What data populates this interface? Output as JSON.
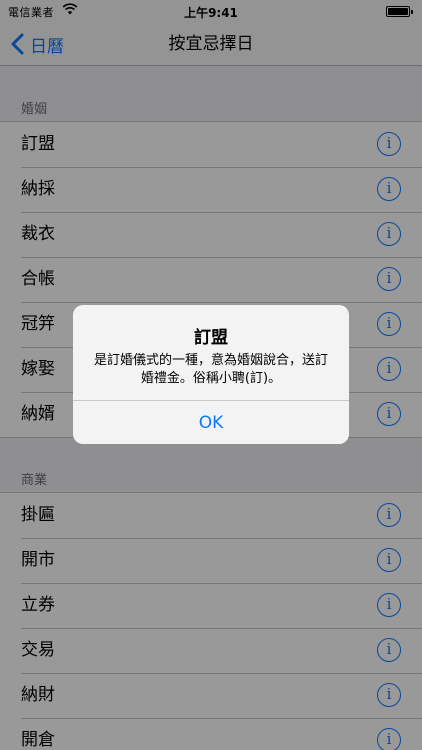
{
  "status_bar": {
    "carrier": "電信業者",
    "time": "上午9:41",
    "battery_level": 1.0
  },
  "nav": {
    "back_label": "日曆",
    "title": "按宜忌擇日"
  },
  "sections": [
    {
      "header": "婚姻",
      "items": [
        "訂盟",
        "納採",
        "裁衣",
        "合帳",
        "冠笄",
        "嫁娶",
        "納婿"
      ]
    },
    {
      "header": "商業",
      "items": [
        "掛匾",
        "開市",
        "立券",
        "交易",
        "納財",
        "開倉"
      ]
    }
  ],
  "info_glyph": "i",
  "alert": {
    "title": "訂盟",
    "message": "是訂婚儀式的一種，意為婚姻說合，送訂婚禮金。俗稱小聘(訂)。",
    "button": "OK"
  },
  "colors": {
    "accent": "#0a7aff",
    "overlay": "rgba(0,0,0,0.4)",
    "background": "#efeff4"
  },
  "icons": {
    "back": "chevron-left-icon",
    "wifi": "wifi-icon",
    "battery": "battery-icon",
    "info": "info-icon"
  }
}
